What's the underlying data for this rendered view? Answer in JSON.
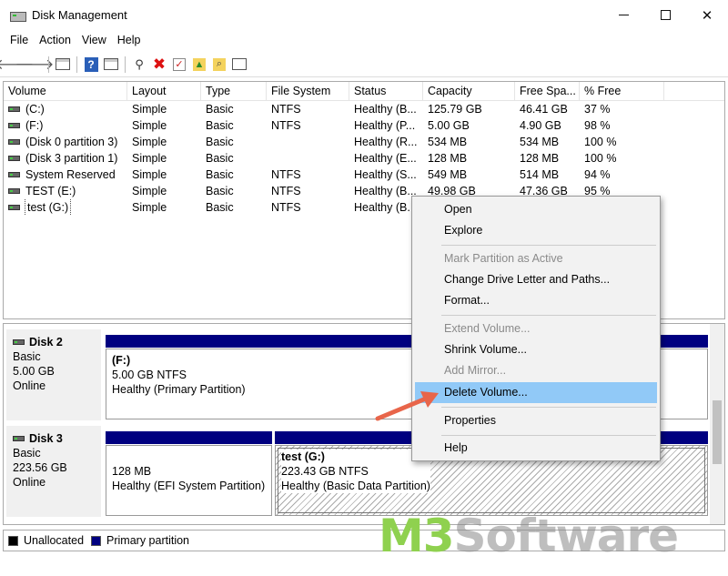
{
  "window": {
    "title": "Disk Management"
  },
  "menubar": [
    "File",
    "Action",
    "View",
    "Help"
  ],
  "columns": [
    "Volume",
    "Layout",
    "Type",
    "File System",
    "Status",
    "Capacity",
    "Free Spa...",
    "% Free"
  ],
  "volumes": [
    [
      "(C:)",
      "Simple",
      "Basic",
      "NTFS",
      "Healthy (B...",
      "125.79 GB",
      "46.41 GB",
      "37 %"
    ],
    [
      "(F:)",
      "Simple",
      "Basic",
      "NTFS",
      "Healthy (P...",
      "5.00 GB",
      "4.90 GB",
      "98 %"
    ],
    [
      "(Disk 0 partition 3)",
      "Simple",
      "Basic",
      "",
      "Healthy (R...",
      "534 MB",
      "534 MB",
      "100 %"
    ],
    [
      "(Disk 3 partition 1)",
      "Simple",
      "Basic",
      "",
      "Healthy (E...",
      "128 MB",
      "128 MB",
      "100 %"
    ],
    [
      "System Reserved",
      "Simple",
      "Basic",
      "NTFS",
      "Healthy (S...",
      "549 MB",
      "514 MB",
      "94 %"
    ],
    [
      "TEST (E:)",
      "Simple",
      "Basic",
      "NTFS",
      "Healthy (B...",
      "49.98 GB",
      "47.36 GB",
      "95 %"
    ],
    [
      "test (G:)",
      "Simple",
      "Basic",
      "NTFS",
      "Healthy (B...",
      "",
      "",
      ""
    ]
  ],
  "disks": [
    {
      "name": "Disk 2",
      "type": "Basic",
      "size": "5.00 GB",
      "status": "Online",
      "partitions": [
        {
          "name": "(F:)",
          "size": "5.00 GB NTFS",
          "status": "Healthy (Primary Partition)"
        }
      ]
    },
    {
      "name": "Disk 3",
      "type": "Basic",
      "size": "223.56 GB",
      "status": "Online",
      "partitions": [
        {
          "name": "",
          "size": "128 MB",
          "status": "Healthy (EFI System Partition)"
        },
        {
          "name": "test  (G:)",
          "size": "223.43 GB NTFS",
          "status": "Healthy (Basic Data Partition)"
        }
      ]
    }
  ],
  "legend": {
    "unallocated": "Unallocated",
    "primary": "Primary partition",
    "unallocated_color": "#000000",
    "primary_color": "#000080"
  },
  "context_menu": [
    {
      "label": "Open",
      "enabled": true
    },
    {
      "label": "Explore",
      "enabled": true
    },
    {
      "label": "Mark Partition as Active",
      "enabled": false
    },
    {
      "label": "Change Drive Letter and Paths...",
      "enabled": true
    },
    {
      "label": "Format...",
      "enabled": true
    },
    {
      "label": "Extend Volume...",
      "enabled": false
    },
    {
      "label": "Shrink Volume...",
      "enabled": true
    },
    {
      "label": "Add Mirror...",
      "enabled": false
    },
    {
      "label": "Delete Volume...",
      "enabled": true,
      "highlighted": true
    },
    {
      "label": "Properties",
      "enabled": true
    },
    {
      "label": "Help",
      "enabled": true
    }
  ],
  "watermark": {
    "brand": "M3",
    "suffix": "Software"
  },
  "colors": {
    "accent_highlight": "#91c9f7",
    "partition_bar": "#000080",
    "arrow": "#e8654a",
    "watermark_green": "#8fd14f"
  }
}
